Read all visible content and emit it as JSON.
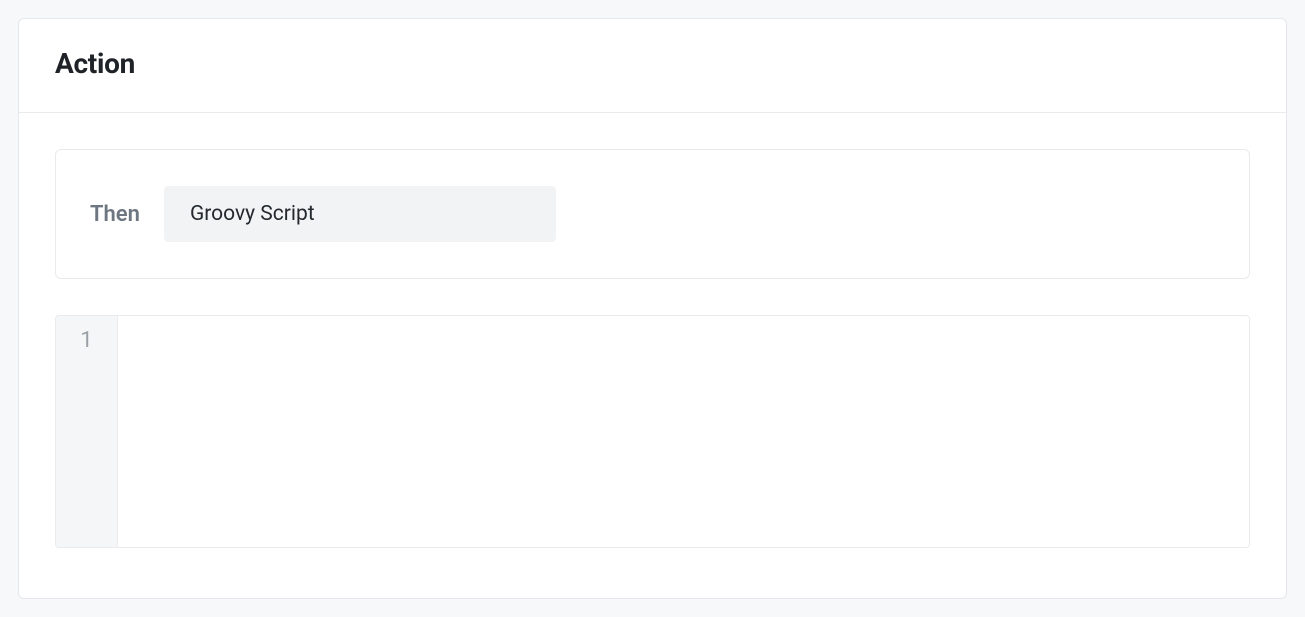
{
  "header": {
    "title": "Action"
  },
  "action": {
    "then_label": "Then",
    "script_type": "Groovy Script"
  },
  "editor": {
    "line_number": "1",
    "content": ""
  }
}
